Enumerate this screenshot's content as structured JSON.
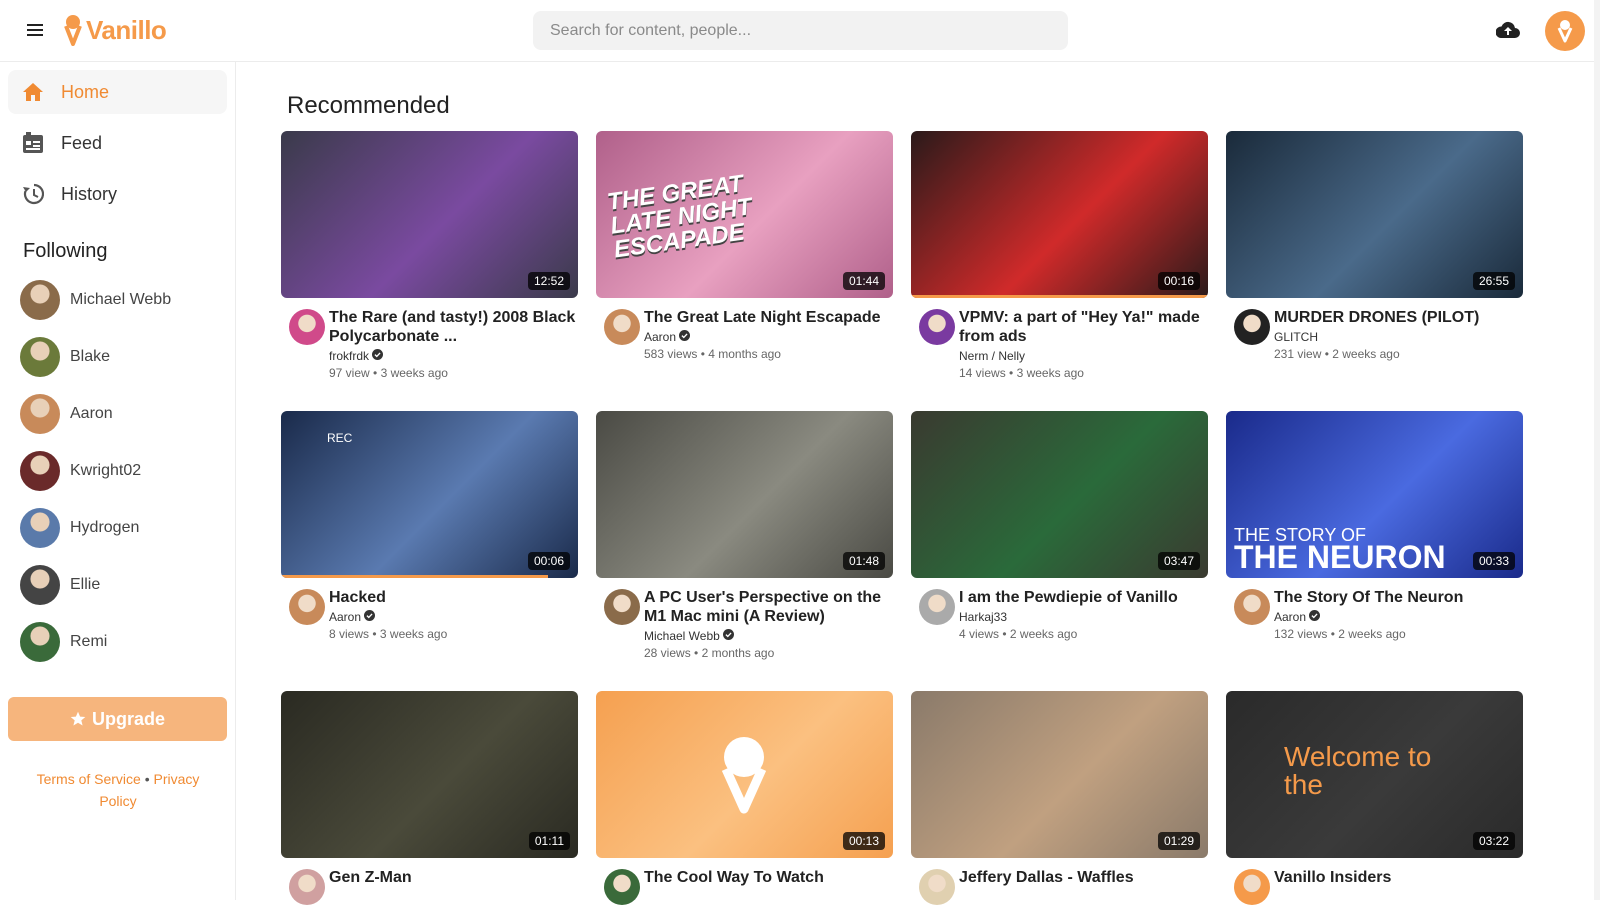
{
  "app": {
    "name": "Vanillo",
    "brand_color": "#f59a4a"
  },
  "search": {
    "placeholder": "Search for content, people..."
  },
  "sidebar": {
    "nav": [
      {
        "label": "Home",
        "icon": "home-icon",
        "active": true
      },
      {
        "label": "Feed",
        "icon": "feed-icon",
        "active": false
      },
      {
        "label": "History",
        "icon": "history-icon",
        "active": false
      }
    ],
    "following_title": "Following",
    "following": [
      {
        "name": "Michael Webb",
        "color": "#8a6b4a"
      },
      {
        "name": "Blake",
        "color": "#6b7a3a"
      },
      {
        "name": "Aaron",
        "color": "#c88a5a"
      },
      {
        "name": "Kwright02",
        "color": "#6a2a2a"
      },
      {
        "name": "Hydrogen",
        "color": "#5a7aaa"
      },
      {
        "name": "Ellie",
        "color": "#444444"
      },
      {
        "name": "Remi",
        "color": "#3a6a3a"
      }
    ],
    "upgrade_label": "Upgrade",
    "footer": {
      "terms": "Terms of Service",
      "sep": "•",
      "privacy": "Privacy Policy"
    }
  },
  "main": {
    "section_title": "Recommended",
    "videos": [
      {
        "title": "The Rare (and tasty!) 2008 Black Polycarbonate ...",
        "channel": "frokfrdk",
        "verified": true,
        "views": "97 view",
        "age": "3 weeks ago",
        "duration": "12:52",
        "bg": "#3a3a4a",
        "accent": "#7a4aa0",
        "avatar": "#d04a8a",
        "progress": 0
      },
      {
        "title": "The Great Late Night Escapade",
        "channel": "Aaron",
        "verified": true,
        "views": "583 views",
        "age": "4 months ago",
        "duration": "01:44",
        "bg": "#b0608a",
        "accent": "#e8a0c0",
        "avatar": "#c88a5a",
        "progress": 0
      },
      {
        "title": "VPMV: a part of \"Hey Ya!\" made from ads",
        "channel": "Nerm / Nelly",
        "verified": false,
        "views": "14 views",
        "age": "3 weeks ago",
        "duration": "00:16",
        "bg": "#2a1a1a",
        "accent": "#d02a2a",
        "avatar": "#7a3aa0",
        "progress": 1.0
      },
      {
        "title": "MURDER DRONES (PILOT)",
        "channel": "GLITCH",
        "verified": false,
        "views": "231 view",
        "age": "2 weeks ago",
        "duration": "26:55",
        "bg": "#1a2a3a",
        "accent": "#4a6a8a",
        "avatar": "#222222",
        "progress": 0
      },
      {
        "title": "Hacked",
        "channel": "Aaron",
        "verified": true,
        "views": "8 views",
        "age": "3 weeks ago",
        "duration": "00:06",
        "bg": "#1a2a4a",
        "accent": "#5a7ab0",
        "avatar": "#c88a5a",
        "progress": 0.9
      },
      {
        "title": "A PC User's Perspective on the M1 Mac mini (A Review)",
        "channel": "Michael Webb",
        "verified": true,
        "views": "28 views",
        "age": "2 months ago",
        "duration": "01:48",
        "bg": "#4a4a44",
        "accent": "#8a8a80",
        "avatar": "#8a6b4a",
        "progress": 0
      },
      {
        "title": "I am the Pewdiepie of Vanillo",
        "channel": "Harkaj33",
        "verified": false,
        "views": "4 views",
        "age": "2 weeks ago",
        "duration": "03:47",
        "bg": "#3a3a30",
        "accent": "#2a6a3a",
        "avatar": "#aaaaaa",
        "progress": 0
      },
      {
        "title": "The Story Of The Neuron",
        "channel": "Aaron",
        "verified": true,
        "views": "132 views",
        "age": "2 weeks ago",
        "duration": "00:33",
        "bg": "#1a2a8a",
        "accent": "#4a6ae0",
        "avatar": "#c88a5a",
        "progress": 0
      },
      {
        "title": "Gen Z-Man",
        "channel": "",
        "verified": false,
        "views": "",
        "age": "",
        "duration": "01:11",
        "bg": "#2a2a22",
        "accent": "#4a4a3a",
        "avatar": "#d0a0a0",
        "progress": 0
      },
      {
        "title": "The Cool Way To Watch",
        "channel": "",
        "verified": false,
        "views": "",
        "age": "",
        "duration": "00:13",
        "bg": "#f5a050",
        "accent": "#fbc080",
        "avatar": "#3a6a3a",
        "progress": 0
      },
      {
        "title": "Jeffery Dallas - Waffles",
        "channel": "",
        "verified": false,
        "views": "",
        "age": "",
        "duration": "01:29",
        "bg": "#8a7a6a",
        "accent": "#c0a080",
        "avatar": "#e0d0b0",
        "progress": 0
      },
      {
        "title": "Vanillo Insiders",
        "channel": "",
        "verified": false,
        "views": "",
        "age": "",
        "duration": "03:22",
        "bg": "#2a2a2a",
        "accent": "#3a3a3a",
        "avatar": "#f59a4a",
        "progress": 0
      }
    ],
    "thumb_texts": {
      "late_night": "THE GREAT LATE NIGHT ESCAPADE",
      "neuron_small": "THE STORY OF",
      "neuron_big": "THE NEURON",
      "welcome": "Welcome to the",
      "rec": "REC"
    }
  }
}
